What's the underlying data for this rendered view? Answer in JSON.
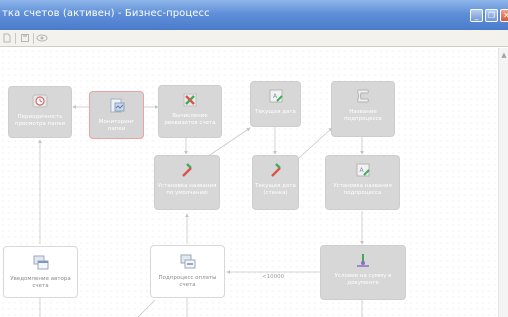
{
  "window": {
    "title": "тка счетов (активен) - Бизнес-процесс",
    "minimize_glyph": "_",
    "restore_glyph": "❐",
    "close_glyph": "✕"
  },
  "toolbar": {
    "icons": [
      "document-icon",
      "save-icon",
      "eye-icon"
    ]
  },
  "nodes": {
    "period": {
      "label": "Периодичность просмотра папки",
      "icon": "clock-icon"
    },
    "monitor": {
      "label": "Мониторинг папки",
      "icon": "folder-monitor-icon"
    },
    "calc": {
      "label": "Вычисление реквизитов счета",
      "icon": "calc-arrows-icon"
    },
    "curdate1": {
      "label": "Текущая дата",
      "icon": "calendar-icon"
    },
    "subproc_name": {
      "label": "Название подпроцесса",
      "icon": "scroll-icon"
    },
    "set_name_default": {
      "label": "Установка названия по умолчанию",
      "icon": "set-arrows-icon"
    },
    "curdate2": {
      "label": "Текущая дата (стенка)",
      "icon": "calendar-icon"
    },
    "set_subproc_name": {
      "label": "Установка названия подпроцесса",
      "icon": "set-calendar-icon"
    },
    "notify": {
      "label": "Уведомление автора счета",
      "icon": "notify-window-icon"
    },
    "pay_subproc": {
      "label": "Подпроцесс оплаты счета",
      "icon": "subprocess-icon"
    },
    "condition": {
      "label": "Условие на сумму в документе",
      "icon": "condition-icon"
    }
  },
  "edges": {
    "threshold_label": "<10000"
  },
  "colors": {
    "titlebar": "#5f8fd8",
    "node_gray": "#d7d7d7",
    "node_selected_border": "#eba2a2",
    "edge": "#c8c8c8"
  }
}
